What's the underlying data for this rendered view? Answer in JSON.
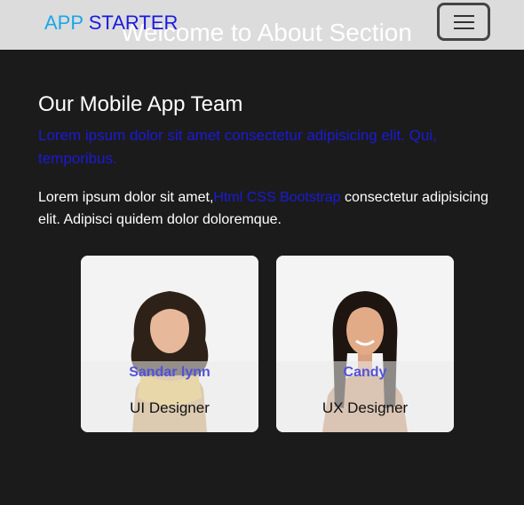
{
  "navbar": {
    "hero_title": "Welcome to About Section",
    "brand_part1": "APP",
    "brand_part2": "STARTER",
    "menu_icon": "hamburger-menu-icon"
  },
  "about": {
    "title": "Our Mobile App Team",
    "lead": "Lorem ipsum dolor sit amet consectetur adipisicing elit. Qui, temporibus.",
    "desc_before": "Lorem ipsum dolor sit amet,",
    "desc_link": "Html CSS Bootstrap",
    "desc_after": " consectetur adipisicing elit. Adipisci quidem dolor doloremque."
  },
  "team": [
    {
      "name": "Sandar lynn",
      "role": "UI Designer"
    },
    {
      "name": "Candy",
      "role": "UX Designer"
    }
  ],
  "colors": {
    "background": "#1b1b1b",
    "navbar": "#dcdcdc",
    "brand_app": "#1aa7e8",
    "brand_starter": "#1a1ae0",
    "accent_blue": "#1a1ad8",
    "card_name": "#5252d8"
  }
}
